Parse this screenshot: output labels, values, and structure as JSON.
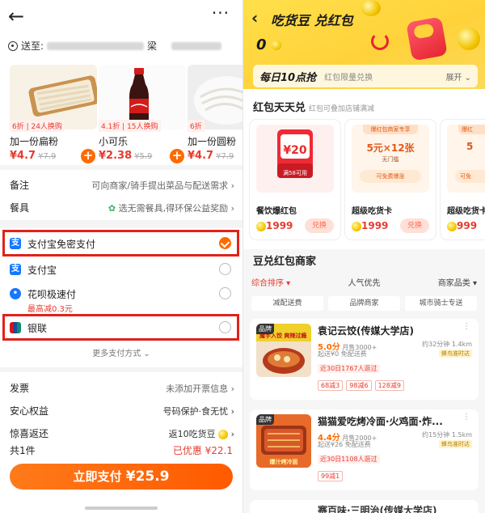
{
  "left": {
    "address_label": "送至:",
    "address_name": "梁",
    "products": [
      {
        "tag": "6折 | 24人换购",
        "name": "加一份扁粉",
        "price": "¥4.7",
        "old_price": "¥7.9",
        "icon": "flat-noodle-image"
      },
      {
        "tag": "4.1折 | 15人换购",
        "name": "小可乐",
        "price": "¥2.38",
        "old_price": "¥5.9",
        "icon": "cola-bottle-image"
      },
      {
        "tag": "6折",
        "name": "加一份圆粉",
        "price": "¥4.7",
        "old_price": "¥7.9",
        "icon": "round-noodle-image"
      }
    ],
    "remark": {
      "label": "备注",
      "value": "可向商家/骑手提出菜品与配送需求"
    },
    "cutlery": {
      "label": "餐具",
      "value": "选无需餐具,得环保公益奖励"
    },
    "payments": [
      {
        "label": "支付宝免密支付",
        "sub": "",
        "selected": true,
        "icon": "alipay-icon"
      },
      {
        "label": "支付宝",
        "sub": "",
        "selected": false,
        "icon": "alipay-icon"
      },
      {
        "label": "花呗极速付",
        "sub": "最高减0.3元",
        "selected": false,
        "icon": "huabei-icon"
      },
      {
        "label": "银联",
        "sub": "",
        "selected": false,
        "icon": "unionpay-icon"
      }
    ],
    "more_payments": "更多支付方式",
    "invoice": {
      "label": "发票",
      "value": "未添加开票信息"
    },
    "assurance": {
      "label": "安心权益",
      "value": "号码保护·食无忧"
    },
    "cashback": {
      "label": "惊喜返还",
      "value": "返10吃货豆"
    },
    "total_count": "共1件",
    "discount": "已优惠 ¥22.1",
    "pay_label": "立即支付",
    "pay_amount": "¥25.9",
    "accent": "#ff6a00",
    "price_color": "#e63b2e"
  },
  "right": {
    "title": "吃货豆 兑红包",
    "balance": "0",
    "daily_title": "每日10点抢",
    "daily_sub": "红包限量兑换",
    "daily_expand": "展开",
    "section_title": "红包天天兑",
    "section_sub": "红包可叠加店铺满减",
    "cards": [
      {
        "name": "餐饮爆红包",
        "price": "1999",
        "btn": "兑换",
        "amount": "¥20",
        "cond": "满58可用",
        "kind": "redpacket"
      },
      {
        "name": "超级吃货卡",
        "price": "1999",
        "btn": "兑换",
        "amount": "5元×12张",
        "cond": "无门槛",
        "top": "爆红包商家专享",
        "bottom": "可免费爆涨"
      },
      {
        "name": "超级吃货卡",
        "price": "999",
        "btn": "",
        "amount": "5",
        "cond": "",
        "top": "爆红",
        "bottom": "可免"
      }
    ],
    "shops_title": "豆兑红包商家",
    "filters": [
      "综合排序",
      "人气优先",
      "商家品类"
    ],
    "chips": [
      "减配送费",
      "品牌商家",
      "城市骑士专送"
    ],
    "shops": [
      {
        "badge": "品牌",
        "name": "袁记云饺(传媒大学店)",
        "rating": "5.0分",
        "sales": "月售3000+",
        "min": "起送¥0 免配送费",
        "dist": "约32分钟 1.4km",
        "bee": "蜂鸟准时达",
        "hot": "近30日1767人逛过",
        "discounts": [
          "68减3",
          "98减6",
          "128减9"
        ]
      },
      {
        "badge": "品牌",
        "name": "猫猫爱吃烤冷面·火鸡面·炸...",
        "rating": "4.4分",
        "sales": "月售2000+",
        "min": "起送¥26 免配送费",
        "dist": "约15分钟 1.5km",
        "bee": "蜂鸟准时达",
        "hot": "近30日1108人逛过",
        "discounts": [
          "99减1"
        ]
      },
      {
        "badge": "",
        "name": "赛百味·三明治(传媒大学店)",
        "rating": "",
        "sales": "",
        "min": "",
        "dist": "",
        "bee": "",
        "hot": "",
        "discounts": []
      }
    ],
    "img_text_1": "魔芋入饺 爽辣过瘾",
    "img_text_2": "爆汁烤冷面"
  }
}
